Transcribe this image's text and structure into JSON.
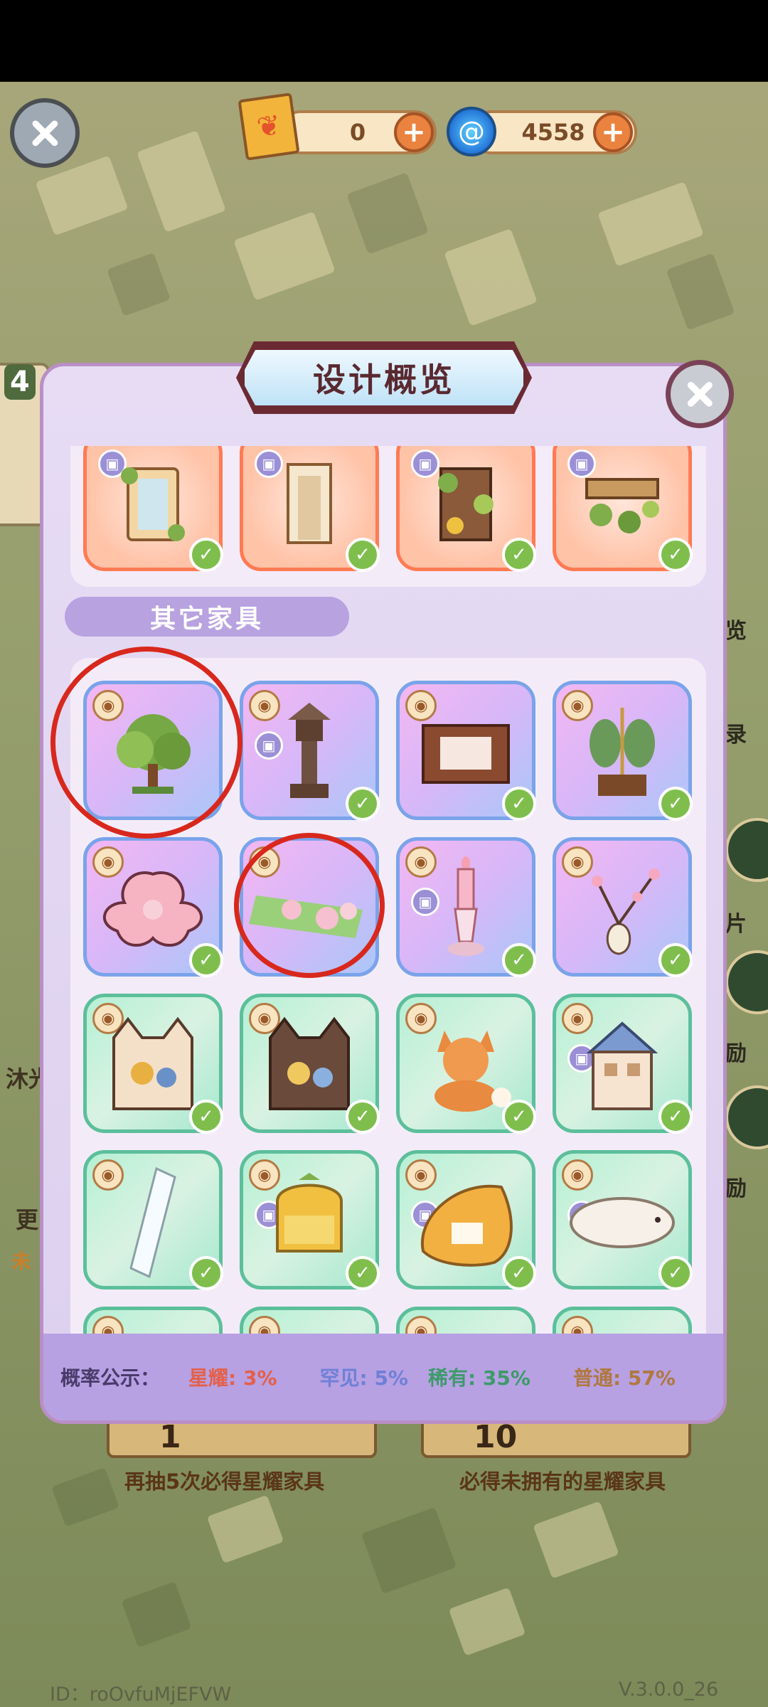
{
  "top_bar": {
    "ticket_count": "0",
    "gem_count": "4558"
  },
  "panel": {
    "title": "设计概览",
    "section_label": "其它家具"
  },
  "probability": {
    "label": "概率公示：",
    "rates": [
      {
        "text": "星耀: 3%",
        "color": "#e4604a"
      },
      {
        "text": "罕见: 5%",
        "color": "#6f7fd6"
      },
      {
        "text": "稀有: 35%",
        "color": "#3d9a6a"
      },
      {
        "text": "普通: 57%",
        "color": "#b07840"
      }
    ]
  },
  "background_text": {
    "left_badge": "4",
    "left_label_1": "沐光",
    "left_label_2": "更",
    "left_label_3": "未",
    "right_labels": [
      "览",
      "录",
      "片",
      "励",
      "励"
    ]
  },
  "bottom": {
    "ticket_left_number": "1",
    "ticket_right_number": "10",
    "caption_left": "再抽5次必得星耀家具",
    "caption_right": "必得未拥有的星耀家具",
    "footer_id": "ID：roOvfuMjEFVW",
    "version": "V.3.0.0_26"
  },
  "icons": {
    "back": "close-icon",
    "panel_close": "close-icon",
    "ticket": "butterfly-ticket-icon",
    "gem": "swirl-gem-icon",
    "plus": "plus-icon",
    "eye": "eye-icon",
    "set": "furniture-set-icon",
    "owned": "check-icon"
  },
  "colors": {
    "annotation": "#d8281d",
    "section_label_bg": "#b8a2e0",
    "probability_bar_bg": "#b7a1e3"
  }
}
